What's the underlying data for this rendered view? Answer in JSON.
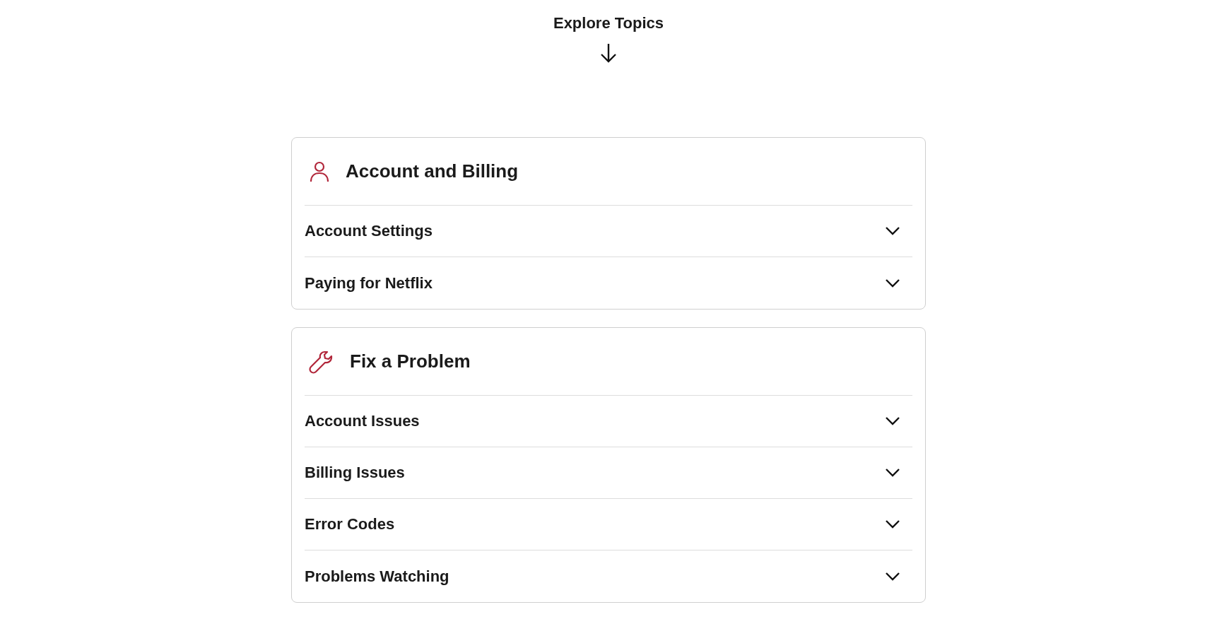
{
  "heading": "Explore Topics",
  "sections": [
    {
      "kind": "person",
      "title": "Account and Billing",
      "items": [
        {
          "label": "Account Settings",
          "expanded": false
        },
        {
          "label": "Paying for Netflix",
          "expanded": false
        }
      ]
    },
    {
      "kind": "wrench",
      "title": "Fix a Problem",
      "items": [
        {
          "label": "Account Issues",
          "expanded": false
        },
        {
          "label": "Billing Issues",
          "expanded": false
        },
        {
          "label": "Error Codes",
          "expanded": false
        },
        {
          "label": "Problems Watching",
          "expanded": false
        }
      ]
    }
  ]
}
